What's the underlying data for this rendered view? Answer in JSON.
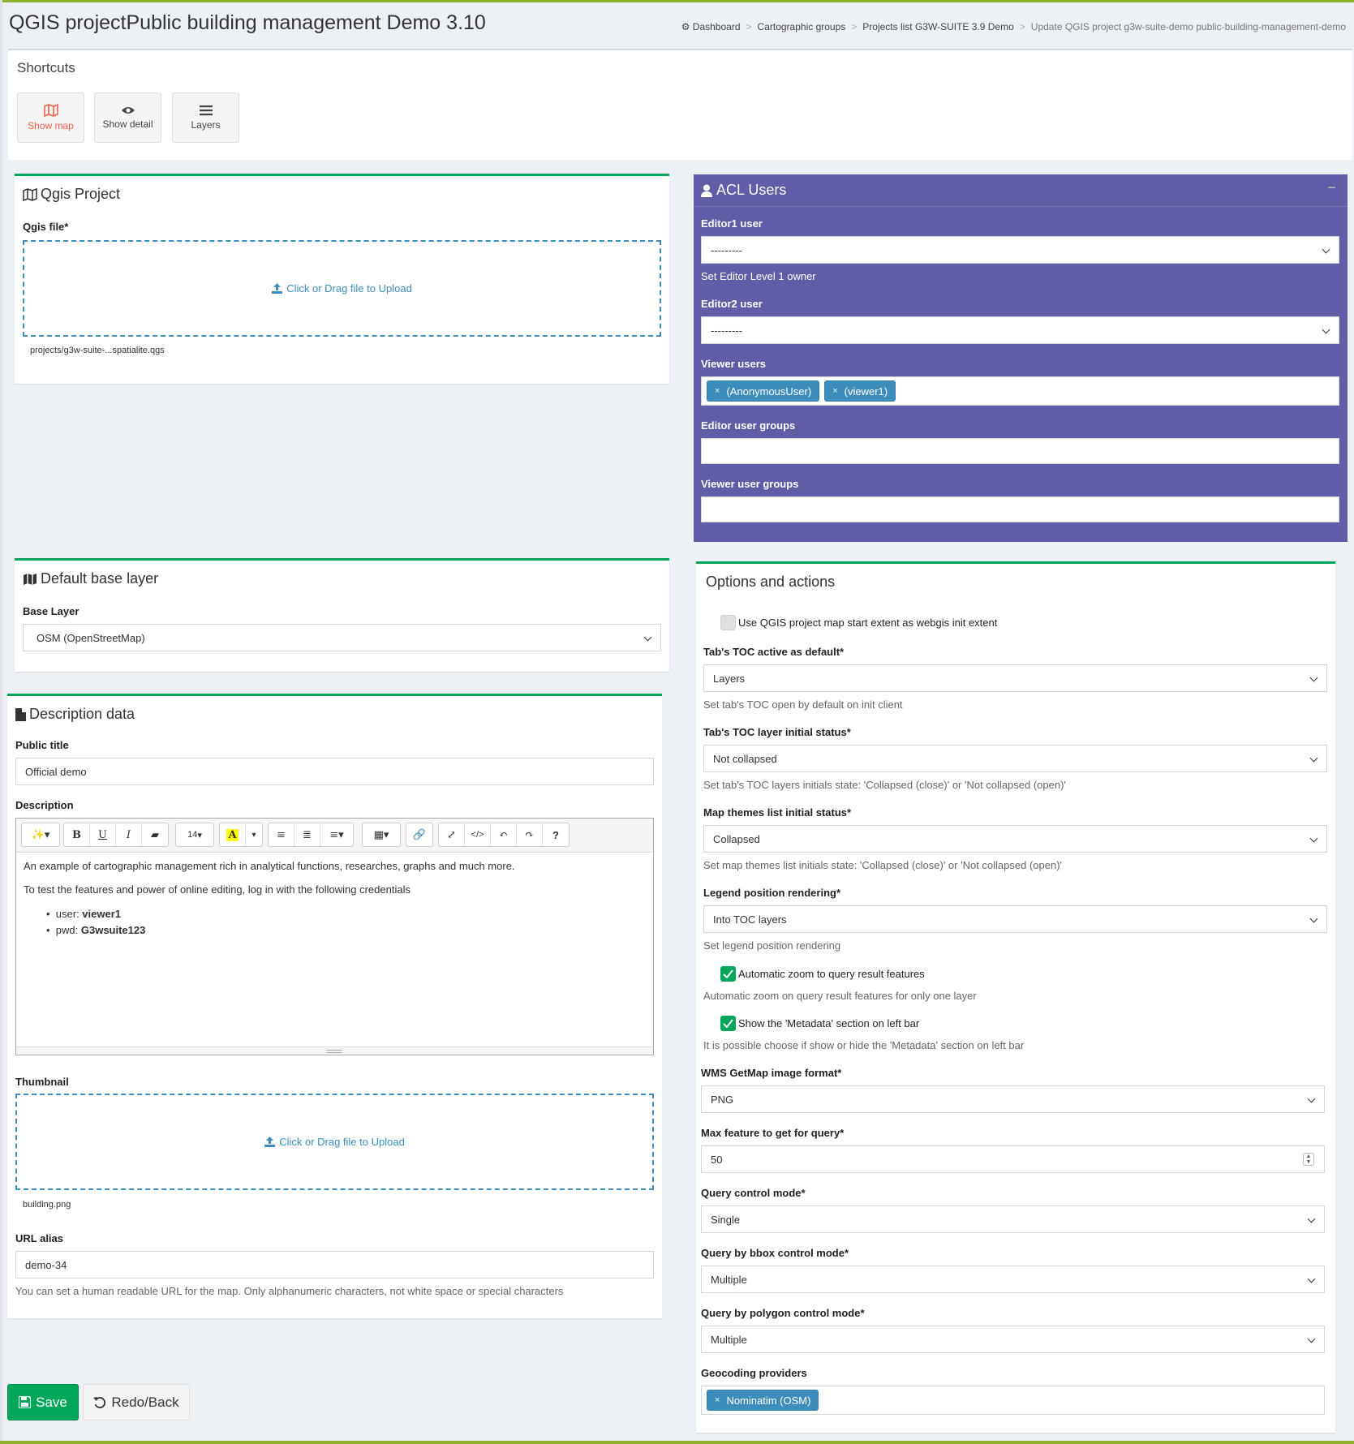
{
  "page": {
    "title": "QGIS projectPublic building management Demo 3.10"
  },
  "breadcrumb": {
    "dashboard": "Dashboard",
    "groups": "Cartographic groups",
    "projects": "Projects list G3W-SUITE 3.9 Demo",
    "current": "Update QGIS project g3w-suite-demo public-building-management-demo",
    "separator": ">"
  },
  "shortcuts": {
    "title": "Shortcuts",
    "show_map": "Show map",
    "show_detail": "Show detail",
    "layers": "Layers"
  },
  "qgis_project": {
    "title": "Qgis Project",
    "file_label": "Qgis file*",
    "upload_text": "Click or Drag file to Upload",
    "current_file": "projects/g3w-suite-...spatialite.qgs"
  },
  "acl": {
    "title": "ACL Users",
    "collapse": "−",
    "editor1_label": "Editor1 user",
    "editor1_value": "---------",
    "editor1_help": "Set Editor Level 1 owner",
    "editor2_label": "Editor2 user",
    "editor2_value": "---------",
    "viewer_label": "Viewer users",
    "viewers": [
      "(AnonymousUser)",
      "(viewer1)"
    ],
    "editor_groups_label": "Editor user groups",
    "viewer_groups_label": "Viewer user groups",
    "tag_remove": "×"
  },
  "base_layer": {
    "title": "Default base layer",
    "label": "Base Layer",
    "value": "OSM (OpenStreetMap)"
  },
  "options": {
    "title": "Options and actions",
    "init_extent_label": "Use QGIS project map start extent as webgis init extent",
    "init_extent_checked": false,
    "toc_tab_label": "Tab's TOC active as default*",
    "toc_tab_value": "Layers",
    "toc_tab_help": "Set tab's TOC open by default on init client",
    "toc_layer_label": "Tab's TOC layer initial status*",
    "toc_layer_value": "Not collapsed",
    "toc_layer_help": "Set tab's TOC layers initials state: 'Collapsed (close)' or 'Not collapsed (open)'",
    "themes_label": "Map themes list initial status*",
    "themes_value": "Collapsed",
    "themes_help": "Set map themes list initials state: 'Collapsed (close)' or 'Not collapsed (open)'",
    "legend_label": "Legend position rendering*",
    "legend_value": "Into TOC layers",
    "legend_help": "Set legend position rendering",
    "autozoom_label": "Automatic zoom to query result features",
    "autozoom_checked": true,
    "autozoom_help": "Automatic zoom on query result features for only one layer",
    "metadata_label": "Show the 'Metadata' section on left bar",
    "metadata_checked": true,
    "metadata_help": "It is possible choose if show or hide the 'Metadata' section on left bar",
    "wms_label": "WMS GetMap image format*",
    "wms_value": "PNG",
    "maxfeat_label": "Max feature to get for query*",
    "maxfeat_value": "50",
    "query_label": "Query control mode*",
    "query_value": "Single",
    "bbox_label": "Query by bbox control mode*",
    "bbox_value": "Multiple",
    "polygon_label": "Query by polygon control mode*",
    "polygon_value": "Multiple",
    "geocoding_label": "Geocoding providers",
    "geocoding_providers": [
      "Nominatim (OSM)"
    ]
  },
  "description": {
    "title": "Description data",
    "public_title_label": "Public title",
    "public_title_value": "Official demo",
    "description_label": "Description",
    "toolbar_fontsize": "14",
    "toolbar_help": "?",
    "toolbar_code": "</>",
    "text_line1": "An example of cartographic management rich in analytical functions, researches, graphs and much more.",
    "text_line2": "To test the features and power of online editing, log in with the following credentials",
    "user_prefix": "user: ",
    "user_value": "viewer1",
    "pwd_prefix": "pwd: ",
    "pwd_value": "G3wsuite123",
    "thumbnail_label": "Thumbnail",
    "thumbnail_upload": "Click or Drag file to Upload",
    "thumbnail_file": "building.png",
    "url_alias_label": "URL alias",
    "url_alias_value": "demo-34",
    "url_alias_help": "You can set a human readable URL for the map. Only alphanumeric characters, not white space or special characters"
  },
  "actions": {
    "save": "Save",
    "back": "Redo/Back"
  },
  "colors": {
    "accent_green": "#00a65a",
    "acl_purple": "#605ca8",
    "link_blue": "#3c8dbc",
    "shortcut_map": "#f3614a"
  }
}
